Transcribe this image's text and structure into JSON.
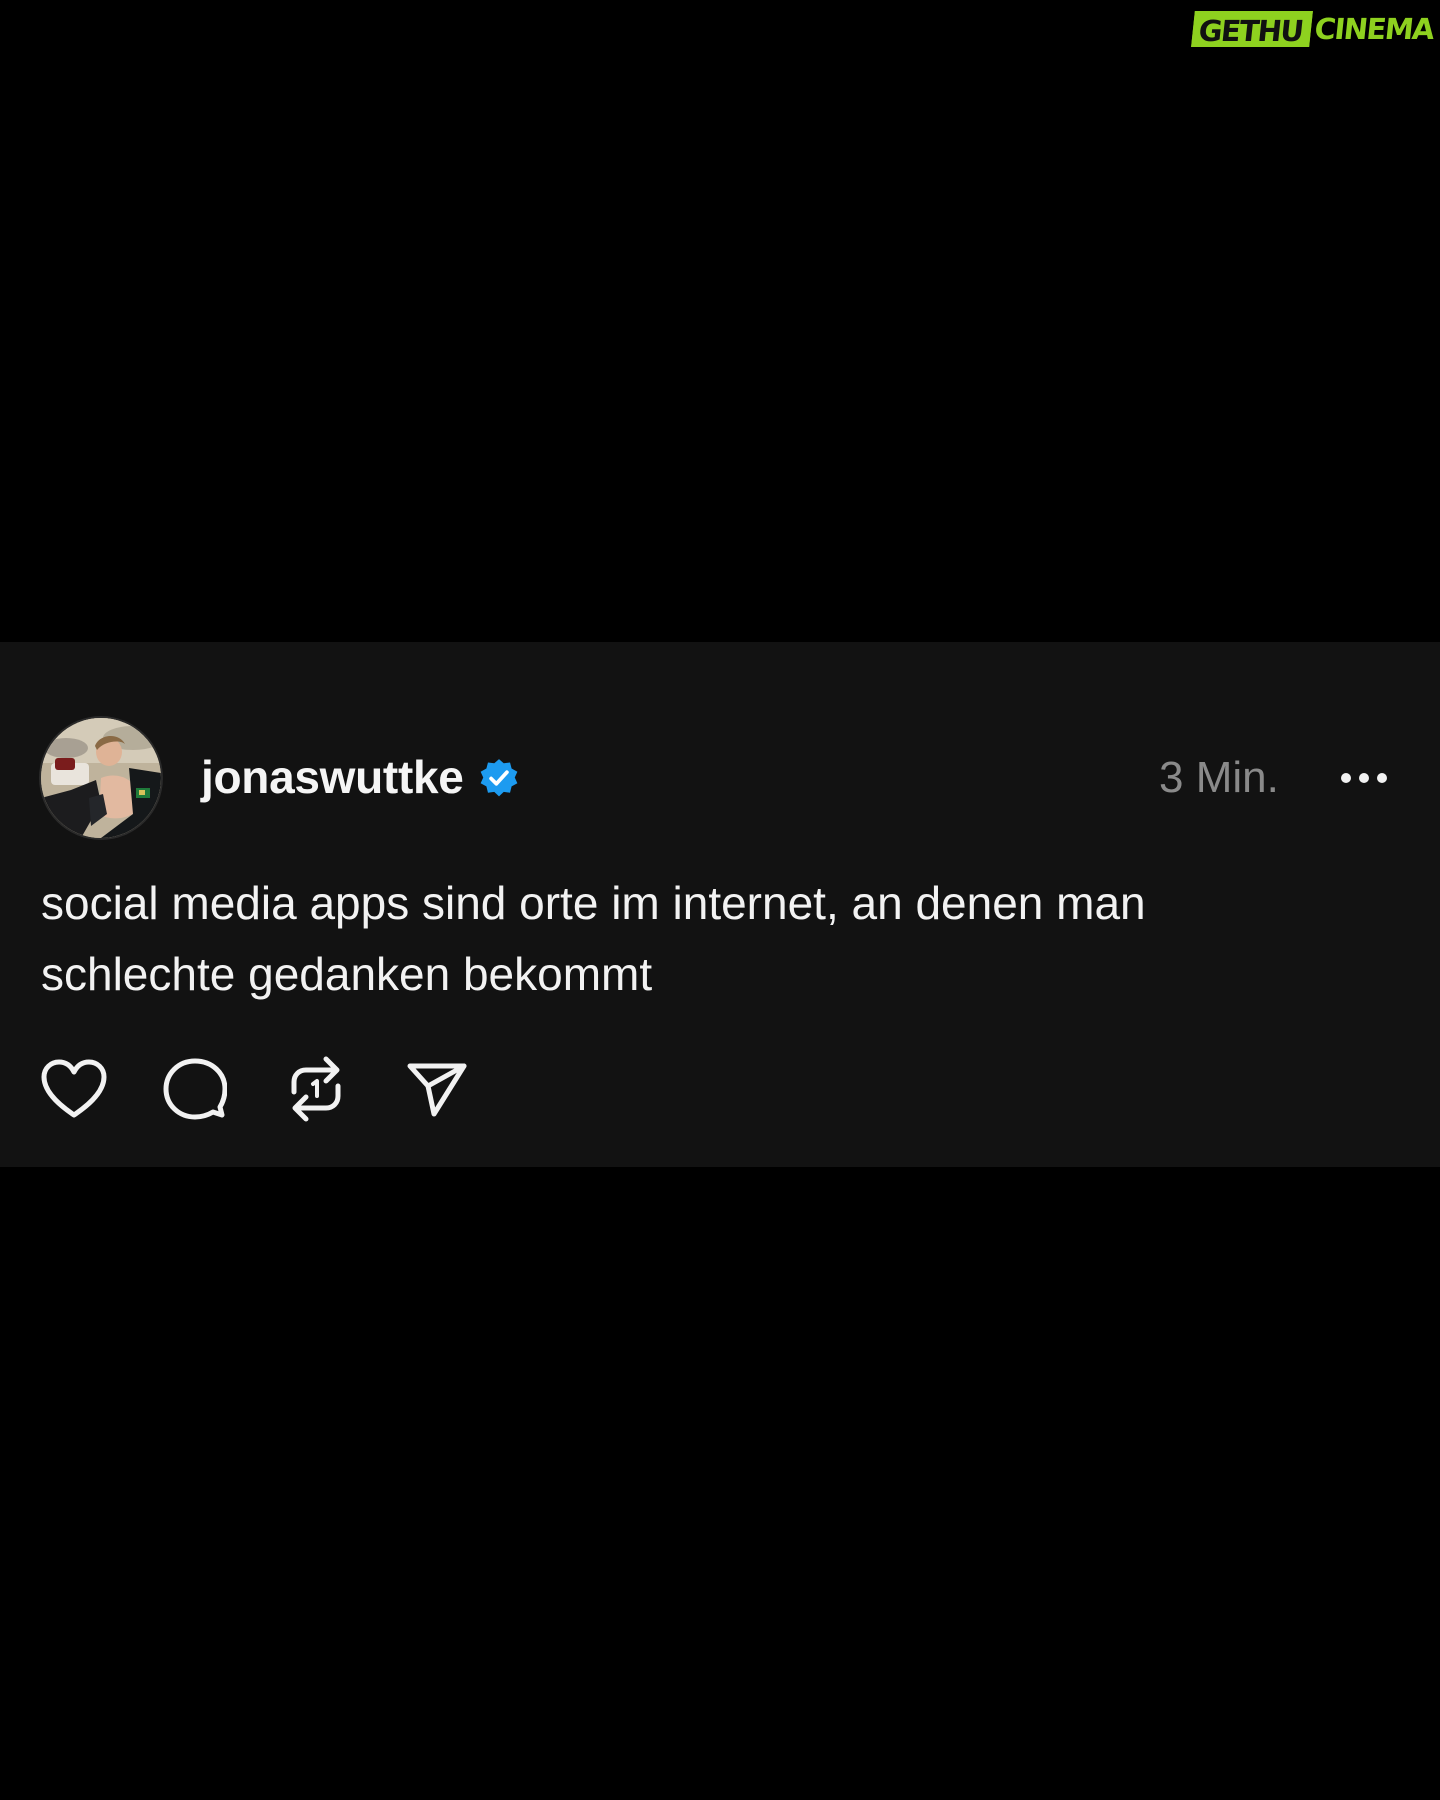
{
  "watermark": {
    "part1": "GETHU",
    "part2": "CINEMA",
    "color": "#8ed11f"
  },
  "post": {
    "username": "jonaswuttke",
    "verified": true,
    "verified_icon": "verified-badge-icon",
    "verified_color": "#1d9bf0",
    "timestamp": "3 Min.",
    "more_icon": "more-options-icon",
    "text": "social media apps sind orte im internet, an denen man\nschlechte gedanken bekommt",
    "actions": [
      {
        "name": "like",
        "icon": "heart-icon"
      },
      {
        "name": "comment",
        "icon": "comment-icon"
      },
      {
        "name": "repost",
        "icon": "repost-icon"
      },
      {
        "name": "share",
        "icon": "send-icon"
      }
    ]
  },
  "colors": {
    "background": "#000000",
    "card": "#121212",
    "text": "#f2f2f2",
    "muted": "#8a8a8a"
  }
}
